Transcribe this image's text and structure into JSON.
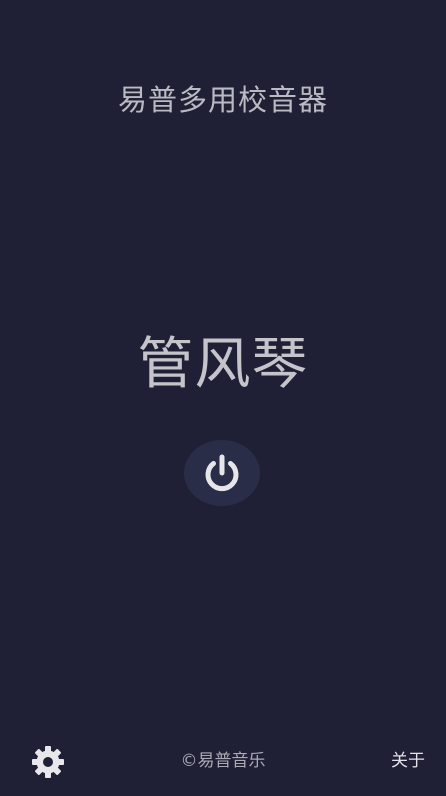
{
  "header": {
    "title": "易普多用校音器"
  },
  "main": {
    "instrument_name": "管风琴",
    "power_button": {
      "icon": "power-icon",
      "state": "off"
    }
  },
  "footer": {
    "settings_icon": "gear-icon",
    "copyright_symbol": "©",
    "brand": "易普音乐",
    "about_label": "关于"
  },
  "colors": {
    "background": "#1f2035",
    "power_button_bg": "#2a2d47",
    "icon": "#e6e6ea",
    "text_muted": "#b9bac2"
  }
}
